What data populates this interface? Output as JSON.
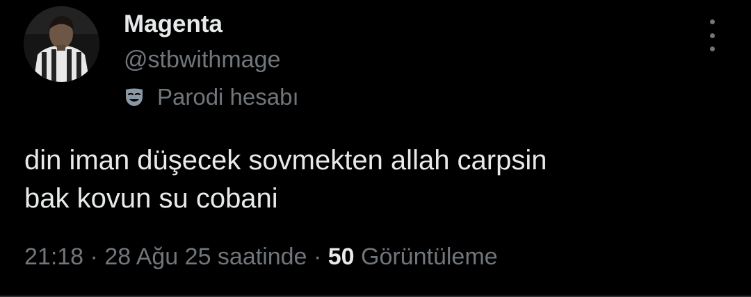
{
  "tweet": {
    "author": {
      "display_name": "Magenta",
      "handle": "@stbwithmage",
      "avatar_icon": "profile-photo-avatar"
    },
    "label": {
      "icon": "theater-mask-icon",
      "text": "Parodi hesabı"
    },
    "more_icon": "more-options-icon",
    "text_lines": [
      "din iman düşecek sovmekten allah carpsin",
      "bak kovun su cobani"
    ],
    "meta": {
      "time": "21:18",
      "separator": "·",
      "date": "28 Ağu 25 saatinde",
      "views_count": "50",
      "views_label": "Görüntüleme"
    }
  },
  "colors": {
    "background": "#000000",
    "primary_text": "#e7e9ea",
    "secondary_text": "#71767b",
    "divider": "#2f3336",
    "mask_icon": "#8b98a5"
  }
}
